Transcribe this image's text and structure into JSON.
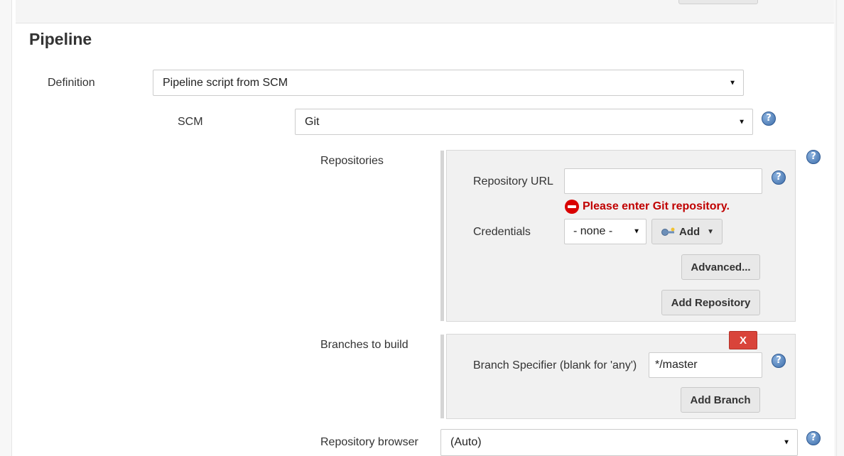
{
  "section": {
    "title": "Pipeline"
  },
  "definition": {
    "label": "Definition",
    "value": "Pipeline script from SCM"
  },
  "scm": {
    "label": "SCM",
    "value": "Git"
  },
  "repositories": {
    "label": "Repositories",
    "url_label": "Repository URL",
    "url_value": "",
    "error": "Please enter Git repository.",
    "credentials_label": "Credentials",
    "credentials_value": "- none -",
    "add_label": "Add",
    "advanced_label": "Advanced...",
    "add_repository_label": "Add Repository"
  },
  "branches": {
    "label": "Branches to build",
    "delete_label": "X",
    "specifier_label": "Branch Specifier (blank for 'any')",
    "specifier_value": "*/master",
    "add_branch_label": "Add Branch"
  },
  "repository_browser": {
    "label": "Repository browser",
    "value": "(Auto)"
  },
  "icons": {
    "help": "help-icon",
    "error": "error-icon",
    "key": "key-icon",
    "caret": "caret-down-icon"
  },
  "colors": {
    "error": "#c00000",
    "delete_button": "#d9443a",
    "help": "#3e6eaa"
  }
}
